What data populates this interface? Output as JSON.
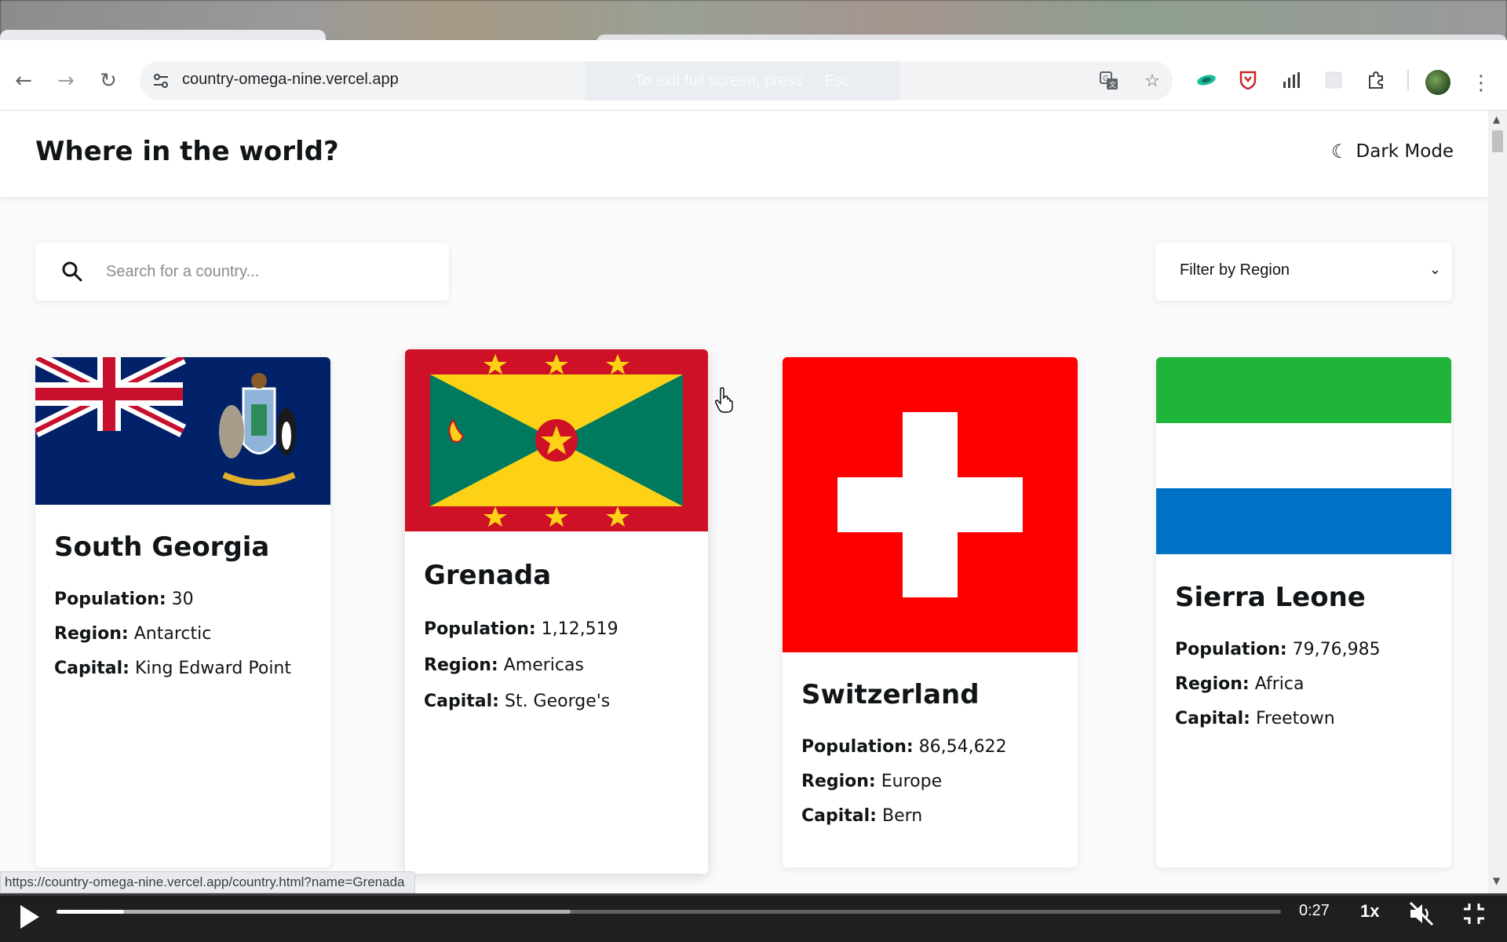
{
  "browser": {
    "url": "country-omega-nine.vercel.app",
    "fullscreen_hint": "To exit full screen, press",
    "fullscreen_key": "Esc",
    "status_url": "https://country-omega-nine.vercel.app/country.html?name=Grenada"
  },
  "app": {
    "title": "Where in the world?",
    "dark_mode_label": "Dark Mode",
    "search_placeholder": "Search for a country...",
    "filter_label": "Filter by Region"
  },
  "labels": {
    "population": "Population:",
    "region": "Region:",
    "capital": "Capital:"
  },
  "countries": [
    {
      "name": "South Georgia",
      "population": "30",
      "region": "Antarctic",
      "capital": "King Edward Point"
    },
    {
      "name": "Grenada",
      "population": "1,12,519",
      "region": "Americas",
      "capital": "St. George's"
    },
    {
      "name": "Switzerland",
      "population": "86,54,622",
      "region": "Europe",
      "capital": "Bern"
    },
    {
      "name": "Sierra Leone",
      "population": "79,76,985",
      "region": "Africa",
      "capital": "Freetown"
    }
  ],
  "player": {
    "time": "0:27",
    "speed": "1x",
    "progress_fraction": 0.055,
    "buffered_fraction": 0.42
  },
  "colors": {
    "accent_text": "#111517",
    "page_bg": "#fafafa"
  }
}
